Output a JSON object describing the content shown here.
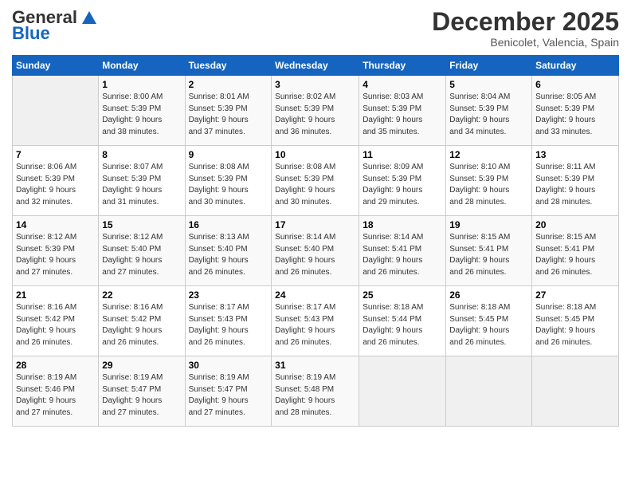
{
  "logo": {
    "line1": "General",
    "line2": "Blue"
  },
  "title": "December 2025",
  "location": "Benicolet, Valencia, Spain",
  "days_header": [
    "Sunday",
    "Monday",
    "Tuesday",
    "Wednesday",
    "Thursday",
    "Friday",
    "Saturday"
  ],
  "weeks": [
    [
      {
        "num": "",
        "sunrise": "",
        "sunset": "",
        "daylight": "",
        "empty": true
      },
      {
        "num": "1",
        "sunrise": "Sunrise: 8:00 AM",
        "sunset": "Sunset: 5:39 PM",
        "daylight": "Daylight: 9 hours and 38 minutes."
      },
      {
        "num": "2",
        "sunrise": "Sunrise: 8:01 AM",
        "sunset": "Sunset: 5:39 PM",
        "daylight": "Daylight: 9 hours and 37 minutes."
      },
      {
        "num": "3",
        "sunrise": "Sunrise: 8:02 AM",
        "sunset": "Sunset: 5:39 PM",
        "daylight": "Daylight: 9 hours and 36 minutes."
      },
      {
        "num": "4",
        "sunrise": "Sunrise: 8:03 AM",
        "sunset": "Sunset: 5:39 PM",
        "daylight": "Daylight: 9 hours and 35 minutes."
      },
      {
        "num": "5",
        "sunrise": "Sunrise: 8:04 AM",
        "sunset": "Sunset: 5:39 PM",
        "daylight": "Daylight: 9 hours and 34 minutes."
      },
      {
        "num": "6",
        "sunrise": "Sunrise: 8:05 AM",
        "sunset": "Sunset: 5:39 PM",
        "daylight": "Daylight: 9 hours and 33 minutes."
      }
    ],
    [
      {
        "num": "7",
        "sunrise": "Sunrise: 8:06 AM",
        "sunset": "Sunset: 5:39 PM",
        "daylight": "Daylight: 9 hours and 32 minutes."
      },
      {
        "num": "8",
        "sunrise": "Sunrise: 8:07 AM",
        "sunset": "Sunset: 5:39 PM",
        "daylight": "Daylight: 9 hours and 31 minutes."
      },
      {
        "num": "9",
        "sunrise": "Sunrise: 8:08 AM",
        "sunset": "Sunset: 5:39 PM",
        "daylight": "Daylight: 9 hours and 30 minutes."
      },
      {
        "num": "10",
        "sunrise": "Sunrise: 8:08 AM",
        "sunset": "Sunset: 5:39 PM",
        "daylight": "Daylight: 9 hours and 30 minutes."
      },
      {
        "num": "11",
        "sunrise": "Sunrise: 8:09 AM",
        "sunset": "Sunset: 5:39 PM",
        "daylight": "Daylight: 9 hours and 29 minutes."
      },
      {
        "num": "12",
        "sunrise": "Sunrise: 8:10 AM",
        "sunset": "Sunset: 5:39 PM",
        "daylight": "Daylight: 9 hours and 28 minutes."
      },
      {
        "num": "13",
        "sunrise": "Sunrise: 8:11 AM",
        "sunset": "Sunset: 5:39 PM",
        "daylight": "Daylight: 9 hours and 28 minutes."
      }
    ],
    [
      {
        "num": "14",
        "sunrise": "Sunrise: 8:12 AM",
        "sunset": "Sunset: 5:39 PM",
        "daylight": "Daylight: 9 hours and 27 minutes."
      },
      {
        "num": "15",
        "sunrise": "Sunrise: 8:12 AM",
        "sunset": "Sunset: 5:40 PM",
        "daylight": "Daylight: 9 hours and 27 minutes."
      },
      {
        "num": "16",
        "sunrise": "Sunrise: 8:13 AM",
        "sunset": "Sunset: 5:40 PM",
        "daylight": "Daylight: 9 hours and 26 minutes."
      },
      {
        "num": "17",
        "sunrise": "Sunrise: 8:14 AM",
        "sunset": "Sunset: 5:40 PM",
        "daylight": "Daylight: 9 hours and 26 minutes."
      },
      {
        "num": "18",
        "sunrise": "Sunrise: 8:14 AM",
        "sunset": "Sunset: 5:41 PM",
        "daylight": "Daylight: 9 hours and 26 minutes."
      },
      {
        "num": "19",
        "sunrise": "Sunrise: 8:15 AM",
        "sunset": "Sunset: 5:41 PM",
        "daylight": "Daylight: 9 hours and 26 minutes."
      },
      {
        "num": "20",
        "sunrise": "Sunrise: 8:15 AM",
        "sunset": "Sunset: 5:41 PM",
        "daylight": "Daylight: 9 hours and 26 minutes."
      }
    ],
    [
      {
        "num": "21",
        "sunrise": "Sunrise: 8:16 AM",
        "sunset": "Sunset: 5:42 PM",
        "daylight": "Daylight: 9 hours and 26 minutes."
      },
      {
        "num": "22",
        "sunrise": "Sunrise: 8:16 AM",
        "sunset": "Sunset: 5:42 PM",
        "daylight": "Daylight: 9 hours and 26 minutes."
      },
      {
        "num": "23",
        "sunrise": "Sunrise: 8:17 AM",
        "sunset": "Sunset: 5:43 PM",
        "daylight": "Daylight: 9 hours and 26 minutes."
      },
      {
        "num": "24",
        "sunrise": "Sunrise: 8:17 AM",
        "sunset": "Sunset: 5:43 PM",
        "daylight": "Daylight: 9 hours and 26 minutes."
      },
      {
        "num": "25",
        "sunrise": "Sunrise: 8:18 AM",
        "sunset": "Sunset: 5:44 PM",
        "daylight": "Daylight: 9 hours and 26 minutes."
      },
      {
        "num": "26",
        "sunrise": "Sunrise: 8:18 AM",
        "sunset": "Sunset: 5:45 PM",
        "daylight": "Daylight: 9 hours and 26 minutes."
      },
      {
        "num": "27",
        "sunrise": "Sunrise: 8:18 AM",
        "sunset": "Sunset: 5:45 PM",
        "daylight": "Daylight: 9 hours and 26 minutes."
      }
    ],
    [
      {
        "num": "28",
        "sunrise": "Sunrise: 8:19 AM",
        "sunset": "Sunset: 5:46 PM",
        "daylight": "Daylight: 9 hours and 27 minutes."
      },
      {
        "num": "29",
        "sunrise": "Sunrise: 8:19 AM",
        "sunset": "Sunset: 5:47 PM",
        "daylight": "Daylight: 9 hours and 27 minutes."
      },
      {
        "num": "30",
        "sunrise": "Sunrise: 8:19 AM",
        "sunset": "Sunset: 5:47 PM",
        "daylight": "Daylight: 9 hours and 27 minutes."
      },
      {
        "num": "31",
        "sunrise": "Sunrise: 8:19 AM",
        "sunset": "Sunset: 5:48 PM",
        "daylight": "Daylight: 9 hours and 28 minutes."
      },
      {
        "num": "",
        "sunrise": "",
        "sunset": "",
        "daylight": "",
        "empty": true
      },
      {
        "num": "",
        "sunrise": "",
        "sunset": "",
        "daylight": "",
        "empty": true
      },
      {
        "num": "",
        "sunrise": "",
        "sunset": "",
        "daylight": "",
        "empty": true
      }
    ]
  ]
}
